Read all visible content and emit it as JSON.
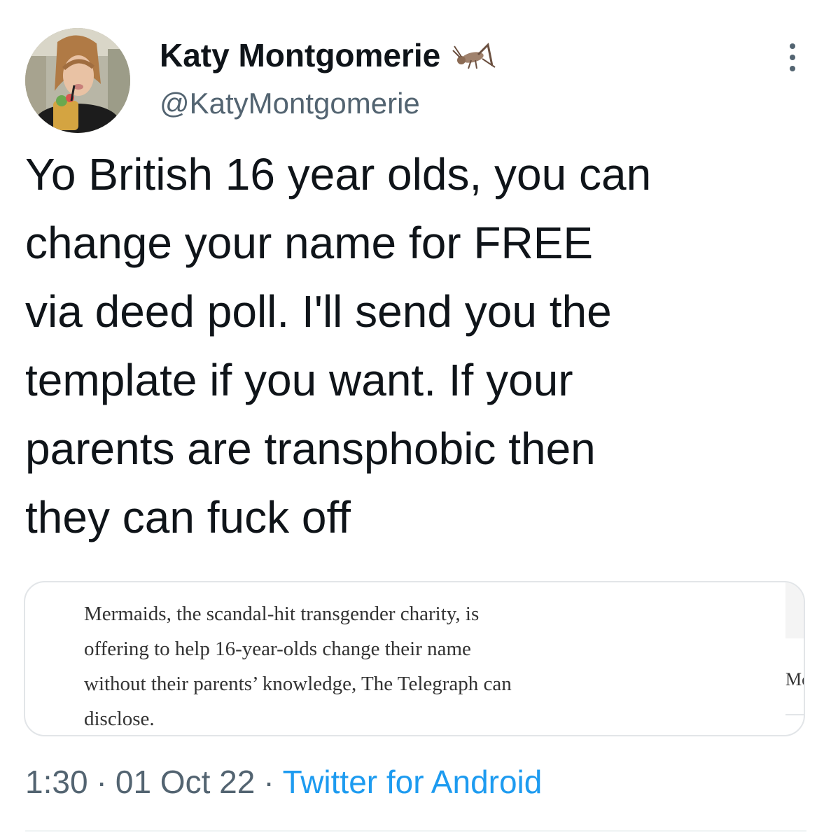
{
  "tweet": {
    "author": {
      "display_name": "Katy Montgomerie",
      "emoji_icon": "cricket-icon",
      "handle": "@KatyMontgomerie"
    },
    "text_lines": [
      "Yo British 16 year olds, you can",
      "change your name for FREE",
      "via deed poll. I'll send you the",
      "template if you want. If your",
      "parents are transphobic then",
      "they can fuck off"
    ],
    "quote": {
      "lines": [
        "Mermaids, the scandal-hit transgender charity, is",
        "offering to help 16-year-olds change their name",
        "without their parents’ knowledge, The Telegraph can",
        "disclose."
      ],
      "side_text": "Mc"
    },
    "meta": {
      "time": "1:30",
      "separator": "·",
      "date": "01 Oct 22",
      "source": "Twitter for Android"
    }
  },
  "colors": {
    "text": "#0f1419",
    "secondary": "#536471",
    "link": "#1d9bf0",
    "border": "#e2e5e8"
  }
}
